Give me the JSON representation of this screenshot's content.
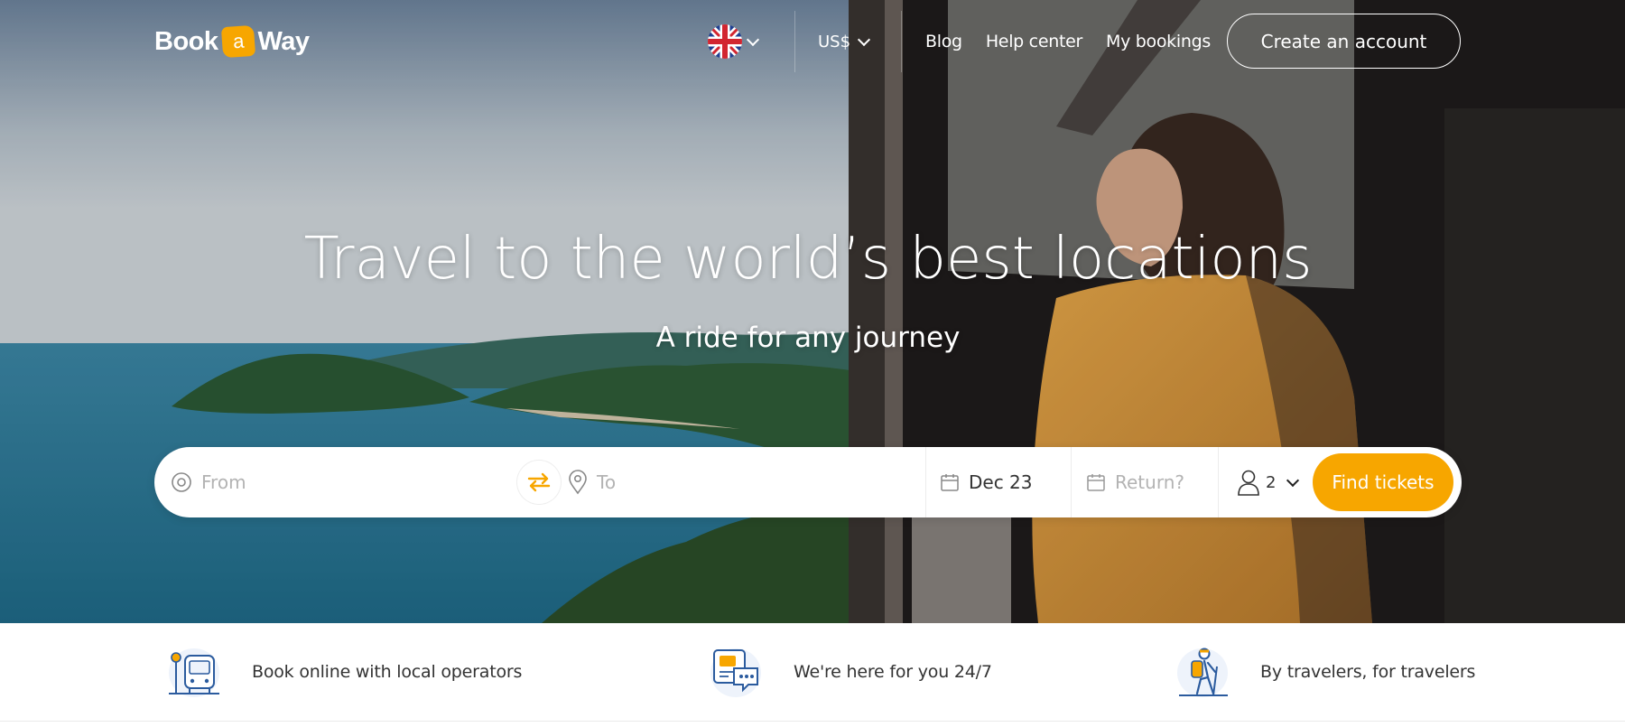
{
  "brand": {
    "logo_left": "Book",
    "logo_badge": "a",
    "logo_right": "Way",
    "accent": "#f7a600"
  },
  "header": {
    "language_icon": "uk-flag-icon",
    "currency": "US$",
    "nav": [
      "Blog",
      "Help center",
      "My bookings"
    ],
    "create_account": "Create an account"
  },
  "hero": {
    "title": "Travel to the world’s best locations",
    "subtitle": "A ride for any journey"
  },
  "search": {
    "from_placeholder": "From",
    "to_placeholder": "To",
    "depart_date": "Dec 23",
    "return_placeholder": "Return?",
    "passengers": "2",
    "submit": "Find tickets"
  },
  "features": [
    {
      "icon": "bus-stop-icon",
      "text": "Book online with local operators"
    },
    {
      "icon": "chat-support-icon",
      "text": "We're here for you 24/7"
    },
    {
      "icon": "hiker-icon",
      "text": "By travelers, for travelers"
    }
  ],
  "colors": {
    "text_dark": "#333333",
    "placeholder": "#b3b3b3",
    "icon_blue": "#2b5b9e"
  }
}
